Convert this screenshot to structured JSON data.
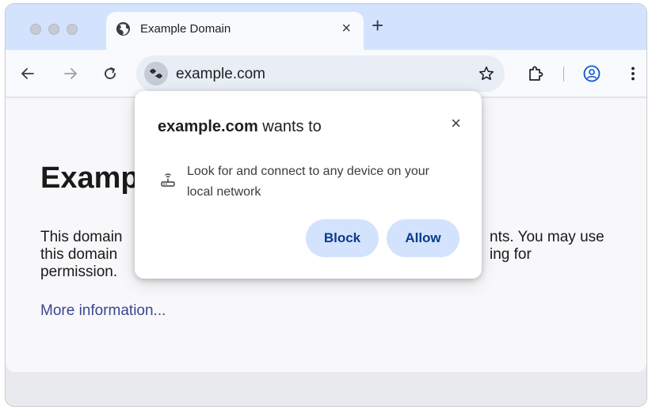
{
  "browser": {
    "tab": {
      "title": "Example Domain",
      "close": "×"
    },
    "new_tab": "+",
    "omnibox": {
      "url": "example.com"
    }
  },
  "page": {
    "heading": "Examp",
    "paragraph": "This domain is for use in illustrative examples in documents. You may use this domain in literature without prior coordination or asking for permission.",
    "paragraph_visible_left": "This domain\nthis domain\npermission.",
    "paragraph_visible_right_1": "nts. You may use",
    "paragraph_visible_right_2": "ing for",
    "link": "More information..."
  },
  "permission_prompt": {
    "site": "example.com",
    "title_suffix": " wants to",
    "close": "×",
    "message": "Look for and connect to any device on your local network",
    "block_label": "Block",
    "allow_label": "Allow"
  },
  "colors": {
    "tabstrip": "#d3e3fd",
    "button_bg": "#d3e3fd",
    "button_text": "#0b3a8a",
    "link": "#38488f"
  },
  "icons": [
    "globe-icon",
    "back-arrow-icon",
    "forward-arrow-icon",
    "reload-icon",
    "site-settings-icon",
    "bookmark-star-icon",
    "extensions-icon",
    "profile-icon",
    "menu-dots-icon",
    "local-network-device-icon"
  ]
}
